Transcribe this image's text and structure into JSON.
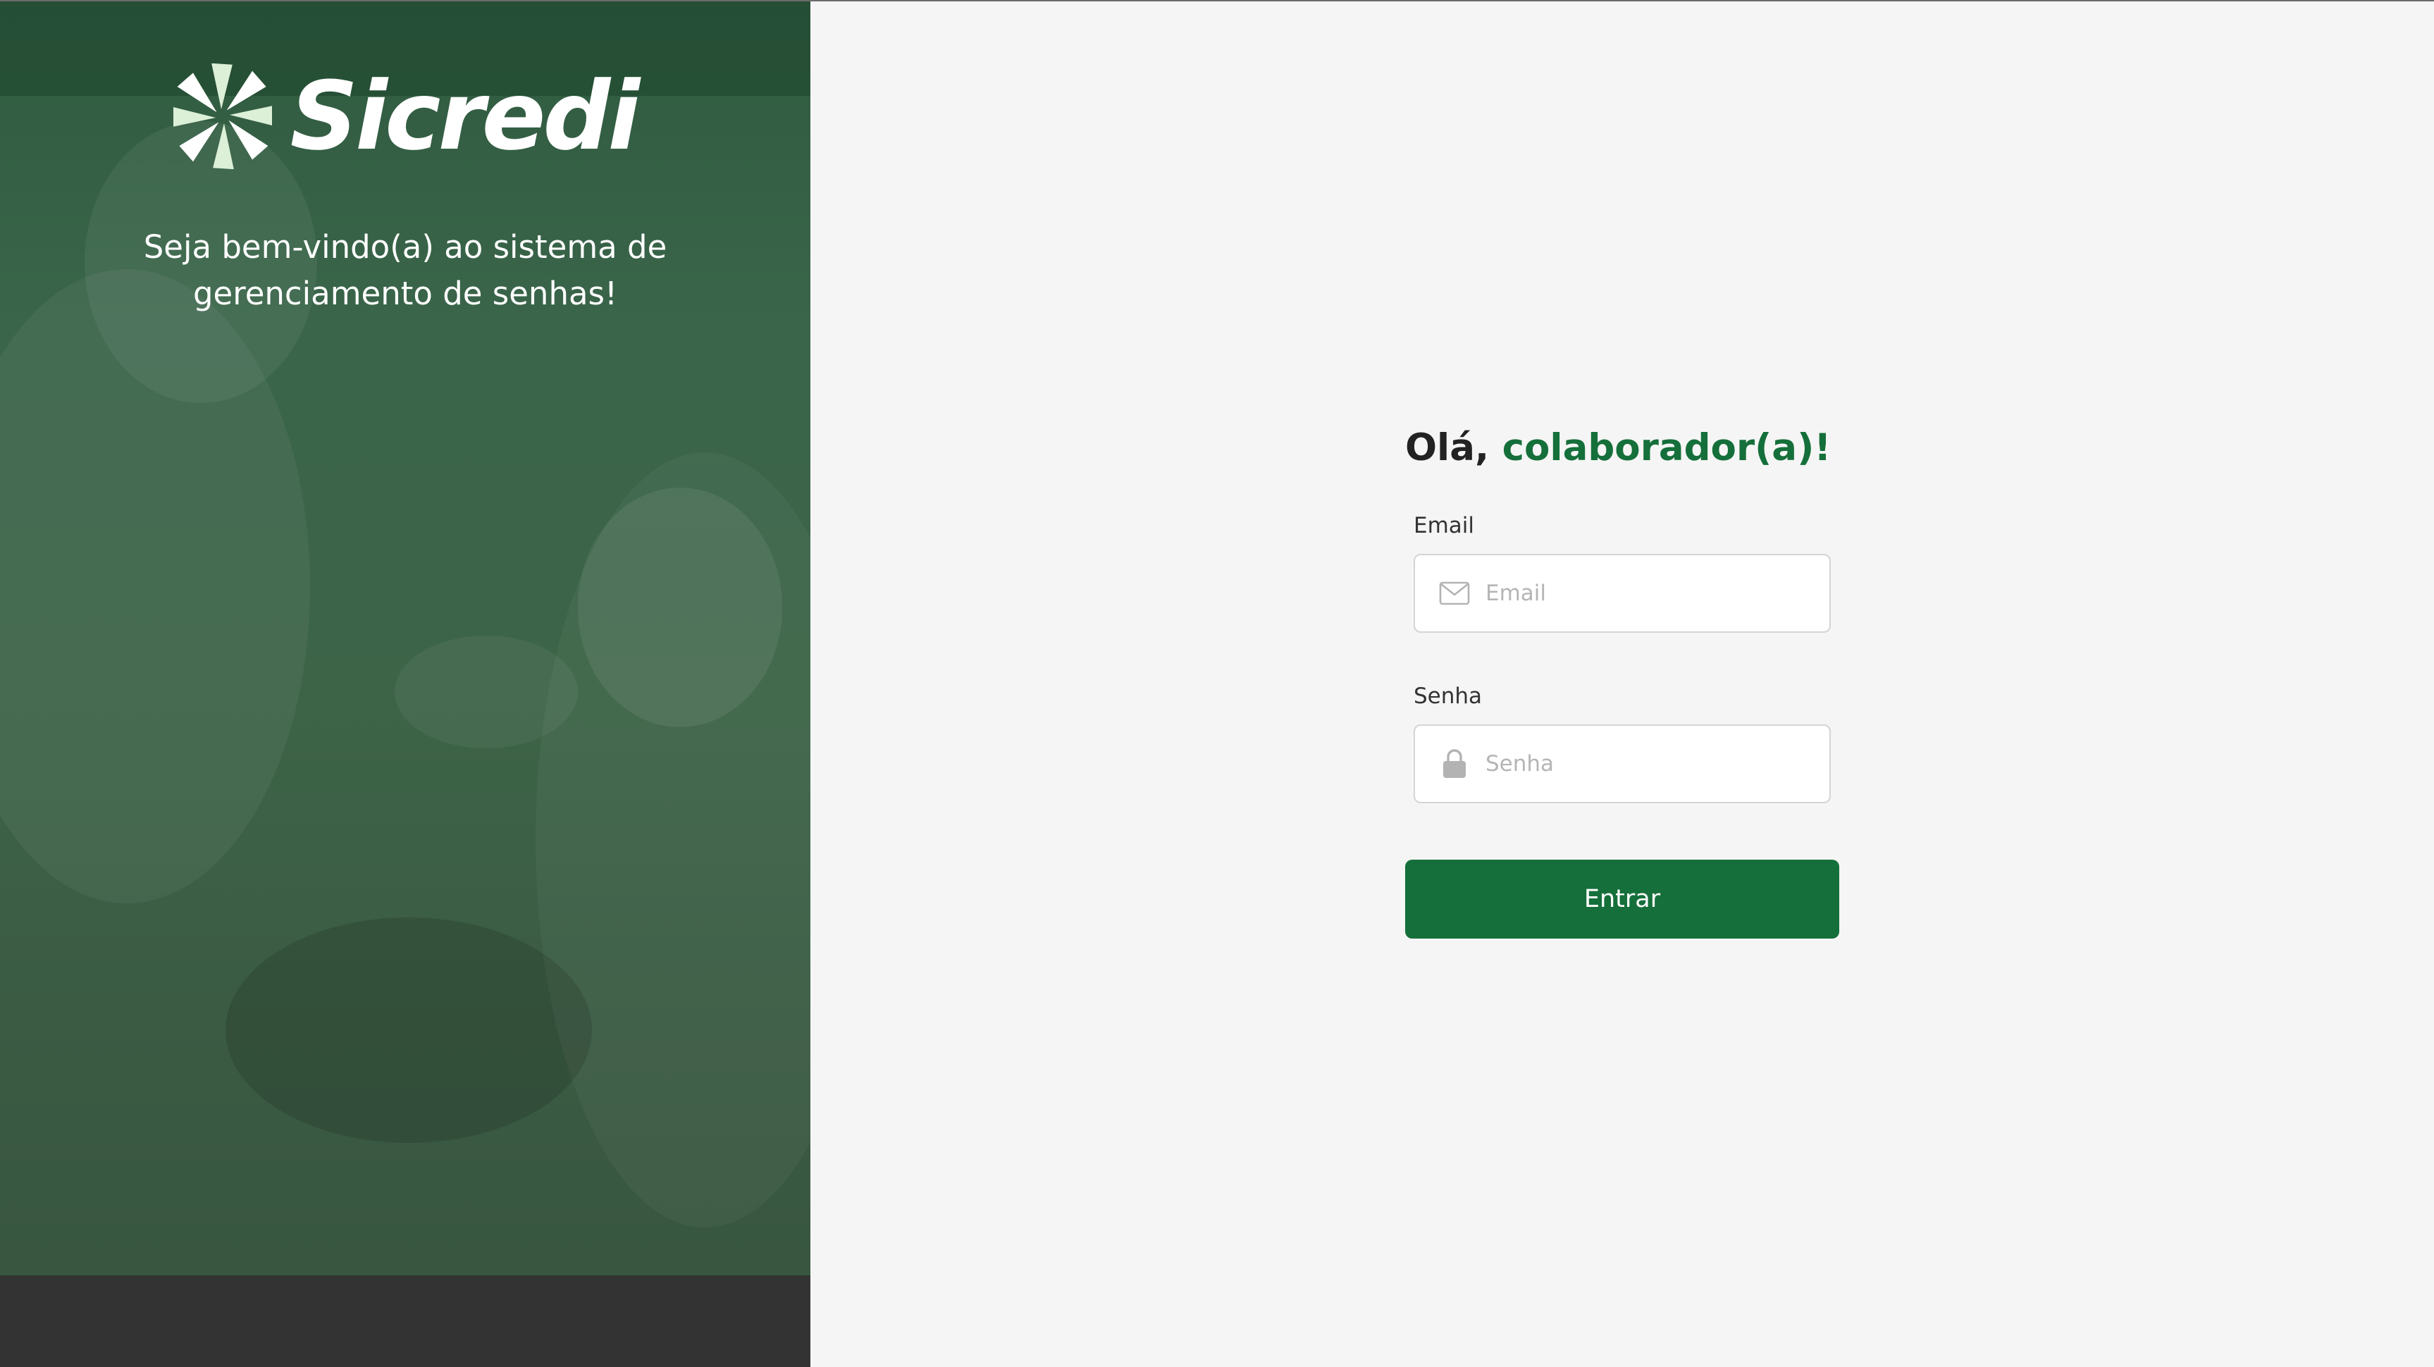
{
  "brand": {
    "name": "Sicredi",
    "logo_icon": "sicredi-pinwheel-icon",
    "welcome_text": "Seja bem-vindo(a) ao sistema de gerenciamento de senhas!"
  },
  "login": {
    "greeting_prefix": "Olá,",
    "greeting_highlight": "colaborador(a)!",
    "email": {
      "label": "Email",
      "placeholder": "Email",
      "value": "",
      "icon": "envelope-icon"
    },
    "password": {
      "label": "Senha",
      "placeholder": "Senha",
      "value": "",
      "icon": "lock-icon"
    },
    "submit_label": "Entrar"
  },
  "colors": {
    "accent": "#156f3a",
    "panel_overlay": "#3a654a",
    "panel_footer": "#333333",
    "background": "#f5f5f5"
  }
}
